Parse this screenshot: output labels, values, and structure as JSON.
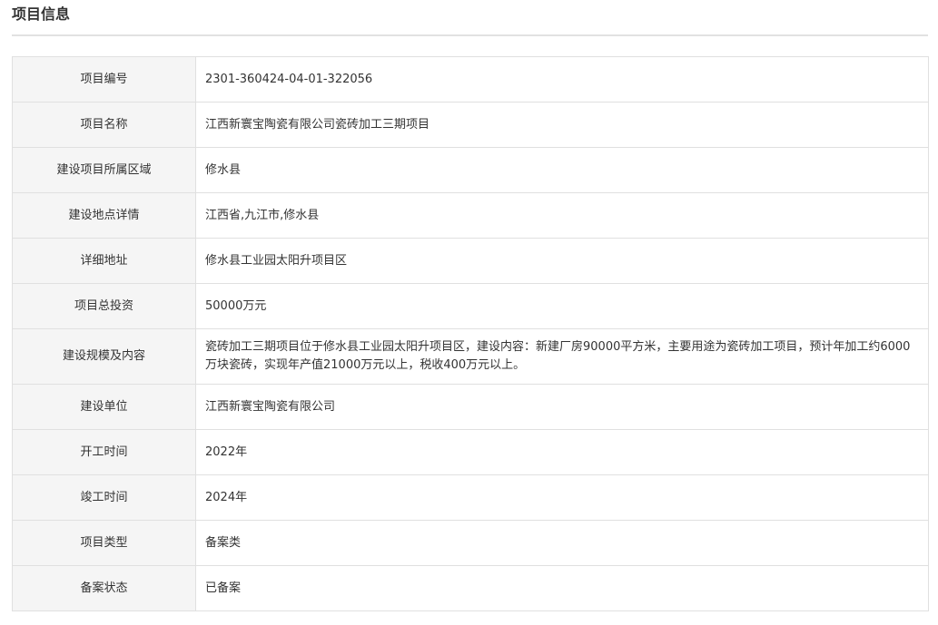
{
  "section": {
    "title": "项目信息"
  },
  "rows": [
    {
      "label": "项目编号",
      "value": "2301-360424-04-01-322056"
    },
    {
      "label": "项目名称",
      "value": "江西新寰宝陶瓷有限公司瓷砖加工三期项目"
    },
    {
      "label": "建设项目所属区域",
      "value": "修水县"
    },
    {
      "label": "建设地点详情",
      "value": "江西省,九江市,修水县"
    },
    {
      "label": "详细地址",
      "value": "修水县工业园太阳升项目区"
    },
    {
      "label": "项目总投资",
      "value": "50000万元"
    },
    {
      "label": "建设规模及内容",
      "value": "瓷砖加工三期项目位于修水县工业园太阳升项目区，建设内容：新建厂房90000平方米，主要用途为瓷砖加工项目，预计年加工约6000万块瓷砖，实现年产值21000万元以上，税收400万元以上。"
    },
    {
      "label": "建设单位",
      "value": "江西新寰宝陶瓷有限公司"
    },
    {
      "label": "开工时间",
      "value": "2022年"
    },
    {
      "label": "竣工时间",
      "value": "2024年"
    },
    {
      "label": "项目类型",
      "value": "备案类"
    },
    {
      "label": "备案状态",
      "value": "已备案"
    }
  ]
}
